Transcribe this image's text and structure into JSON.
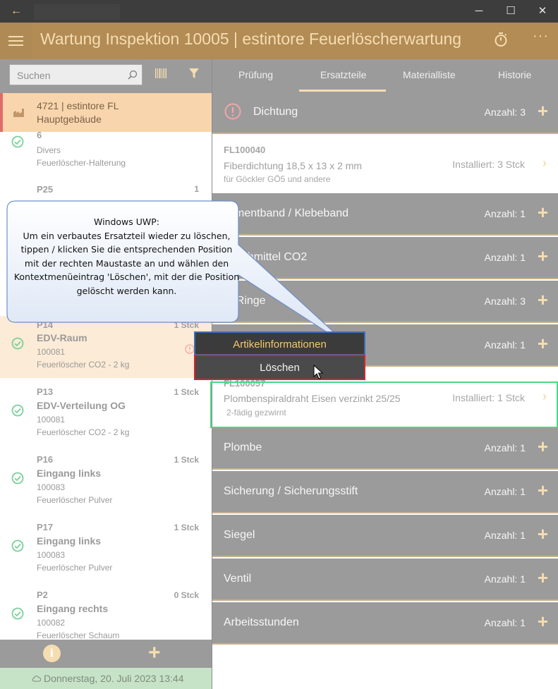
{
  "window": {
    "back_icon": "arrow-left-icon",
    "minimize_glyph": "─",
    "maximize_glyph": "☐",
    "close_glyph": "✕"
  },
  "header": {
    "title": "Wartung Inspektion 10005  |  estintore Feuerlöscherwartung",
    "more_glyph": "···"
  },
  "sidebar": {
    "search_placeholder": "Suchen",
    "selected": {
      "line1": "4721  |  estintore FL",
      "line2": "Hauptgebäude"
    },
    "items": [
      {
        "pos": "6",
        "count": "",
        "name": "",
        "number": "Divers",
        "desc": "Feuerlöscher-Halterung",
        "status": "ok"
      },
      {
        "pos": "P25",
        "count": "1",
        "name": "",
        "number": "",
        "desc": "",
        "status": "hidden"
      },
      {
        "pos": "P14",
        "count": "1 Stck",
        "name": "EDV-Raum",
        "number": "100081",
        "desc": "Feuerlöscher CO2  -  2 kg",
        "status": "ok"
      },
      {
        "pos": "P13",
        "count": "1 Stck",
        "name": "EDV-Verteilung OG",
        "number": "100081",
        "desc": "Feuerlöscher CO2  -  2 kg",
        "status": "ok"
      },
      {
        "pos": "P16",
        "count": "1 Stck",
        "name": "Eingang links",
        "number": "100083",
        "desc": "Feuerlöscher Pulver",
        "status": "ok"
      },
      {
        "pos": "P17",
        "count": "1 Stck",
        "name": "Eingang links",
        "number": "100083",
        "desc": "Feuerlöscher Pulver",
        "status": "ok"
      },
      {
        "pos": "P2",
        "count": "0 Stck",
        "name": "Eingang rechts",
        "number": "100082",
        "desc": "Feuerlöscher Schaum",
        "status": "ok"
      }
    ],
    "footer_plus": "+",
    "info_glyph": "i",
    "status_text": "Donnerstag, 20. Juli 2023 13:44"
  },
  "tabs": [
    "Prüfung",
    "Ersatzteile",
    "Materialliste",
    "Historie"
  ],
  "active_tab": "Ersatzteile",
  "parts": {
    "groups": [
      {
        "title": "Dichtung",
        "amount": "Anzahl: 3",
        "warn": true
      },
      {
        "title": "Armentband / Klebeband",
        "amount": "Anzahl: 1"
      },
      {
        "title": "Löschmittel CO2",
        "amount": "Anzahl: 1"
      },
      {
        "title": "O-Ringe",
        "amount": "Anzahl: 3"
      },
      {
        "title": "",
        "amount": "Anzahl: 1"
      },
      {
        "title": "Plombe",
        "amount": "Anzahl: 1"
      },
      {
        "title": "Sicherung / Sicherungsstift",
        "amount": "Anzahl: 1"
      },
      {
        "title": "Siegel",
        "amount": "Anzahl: 1"
      },
      {
        "title": "Ventil",
        "amount": "Anzahl: 1"
      },
      {
        "title": "Arbeitsstunden",
        "amount": "Anzahl: 1"
      }
    ],
    "items": [
      {
        "article": "FL100040",
        "description": "Fiberdichtung 18,5 x 13 x 2 mm",
        "sub": "für Göckler GÖ5 und andere",
        "installed": "Installiert: 3 Stck"
      },
      {
        "article": "FL100057",
        "description": "Plombenspiraldraht Eisen verzinkt 25/25",
        "sub": "2-fädig gezwirnt",
        "installed": "Installiert: 1 Stck"
      }
    ],
    "plus": "+",
    "chevron": "›"
  },
  "context_menu": {
    "item_info": "Artikelinformationen",
    "item_delete": "Löschen"
  },
  "callout": {
    "heading": "Windows UWP:",
    "text": "Um ein verbautes Ersatzteil wieder zu löschen, tippen / klicken Sie die entsprechenden Position mit der rechten Maustaste an und wählen den Kontextmenüeintrag 'Löschen', mit der die Position gelöscht werden kann."
  },
  "colors": {
    "accent": "#f6ddb1",
    "header": "#b28b55",
    "gray_panel": "#9b9b9b",
    "highlight_green": "#46d987",
    "menu_red": "#d6242a",
    "menu_blue": "#3d6fb7"
  }
}
